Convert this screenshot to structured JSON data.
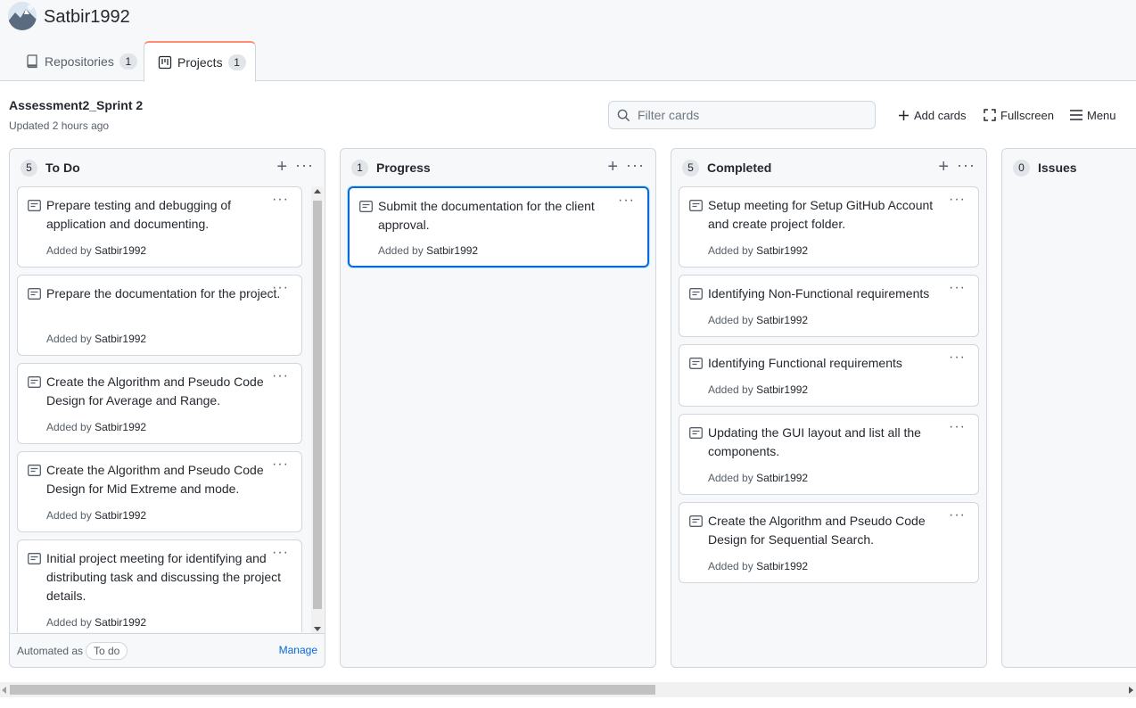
{
  "org": {
    "name": "Satbir1992"
  },
  "tabs": [
    {
      "label": "Repositories",
      "count": "1",
      "icon": "repo-icon"
    },
    {
      "label": "Projects",
      "count": "1",
      "icon": "project-icon"
    }
  ],
  "project": {
    "title": "Assessment2_Sprint 2",
    "updated": "Updated 2 hours ago"
  },
  "toolbar": {
    "filter_placeholder": "Filter cards",
    "add_cards": "Add cards",
    "fullscreen": "Fullscreen",
    "menu": "Menu"
  },
  "columns": {
    "todo": {
      "name": "To Do",
      "count": "5",
      "cards": [
        {
          "note": "Prepare testing and debugging of application and documenting.",
          "added_by": "Added by",
          "user": "Satbir1992"
        },
        {
          "note": "Prepare the documentation for the project.",
          "added_by": "Added by",
          "user": "Satbir1992"
        },
        {
          "note": "Create the Algorithm and Pseudo Code Design for Average and Range.",
          "added_by": "Added by",
          "user": "Satbir1992"
        },
        {
          "note": "Create the Algorithm and Pseudo Code Design for Mid Extreme and mode.",
          "added_by": "Added by",
          "user": "Satbir1992"
        },
        {
          "note": "Initial project meeting for identifying and distributing task and discussing the project details.",
          "added_by": "Added by",
          "user": "Satbir1992"
        }
      ],
      "footer": {
        "label": "Automated as",
        "pill": "To do",
        "manage": "Manage"
      }
    },
    "progress": {
      "name": "Progress",
      "count": "1",
      "cards": [
        {
          "note": "Submit the documentation for the client approval.",
          "added_by": "Added by",
          "user": "Satbir1992"
        }
      ]
    },
    "completed": {
      "name": "Completed",
      "count": "5",
      "cards": [
        {
          "note": "Setup meeting for Setup GitHub Account and create project folder.",
          "added_by": "Added by",
          "user": "Satbir1992"
        },
        {
          "note": "Identifying Non-Functional requirements",
          "added_by": "Added by",
          "user": "Satbir1992"
        },
        {
          "note": "Identifying Functional requirements",
          "added_by": "Added by",
          "user": "Satbir1992"
        },
        {
          "note": "Updating the GUI layout and list all the components.",
          "added_by": "Added by",
          "user": "Satbir1992"
        },
        {
          "note": "Create the Algorithm and Pseudo Code Design for Sequential Search.",
          "added_by": "Added by",
          "user": "Satbir1992"
        }
      ]
    },
    "issues": {
      "name": "Issues",
      "count": "0",
      "cards": []
    }
  },
  "colors": {
    "accent": "#0969da",
    "tab_underline": "#fd8c73",
    "border": "#d0d7de",
    "column_bg": "#f6f8fa"
  }
}
